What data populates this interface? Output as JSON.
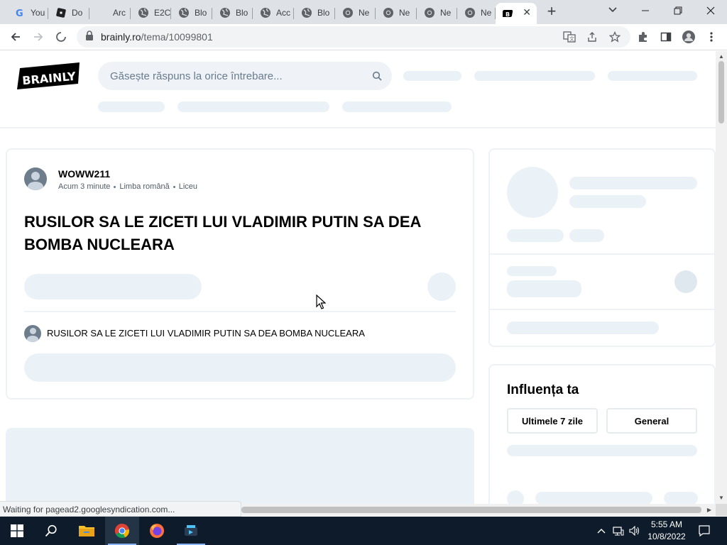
{
  "browser": {
    "tabs": [
      {
        "label": "You",
        "icon": "google-icon"
      },
      {
        "label": "Do",
        "icon": "roblox-icon"
      },
      {
        "label": "Arc",
        "icon": "blank-icon"
      },
      {
        "label": "E2C",
        "icon": "globe-icon"
      },
      {
        "label": "Blo",
        "icon": "globe-icon"
      },
      {
        "label": "Blo",
        "icon": "globe-icon"
      },
      {
        "label": "Acc",
        "icon": "globe-icon"
      },
      {
        "label": "Blo",
        "icon": "globe-icon"
      },
      {
        "label": "Ne",
        "icon": "chrome-icon"
      },
      {
        "label": "Ne",
        "icon": "chrome-icon"
      },
      {
        "label": "Ne",
        "icon": "chrome-icon"
      },
      {
        "label": "Ne",
        "icon": "chrome-icon"
      }
    ],
    "active_tab_icon": "brainly-icon",
    "url_host": "brainly.ro",
    "url_path": "/tema/10099801",
    "status_text": "Waiting for pagead2.googlesyndication.com..."
  },
  "header": {
    "logo_text": "BRAINLY",
    "search_placeholder": "Găsește răspuns la orice întrebare..."
  },
  "question": {
    "author": "WOWW211",
    "time": "Acum 3 minute",
    "subject": "Limba română",
    "level": "Liceu",
    "title": "RUSILOR SA LE ZICETI LUI VLADIMIR PUTIN SA DEA BOMBA NUCLEARA",
    "text": "RUSILOR SA LE ZICETI LUI VLADIMIR PUTIN SA DEA BOMBA NUCLEARA"
  },
  "sidebar": {
    "influence_title": "Influența ta",
    "tab_week": "Ultimele 7 zile",
    "tab_general": "General"
  },
  "taskbar": {
    "time": "5:55 AM",
    "date": "10/8/2022"
  },
  "colors": {
    "skeleton": "#ebf2f7",
    "brand_dark": "#000000",
    "taskbar": "#0d1b2a"
  }
}
